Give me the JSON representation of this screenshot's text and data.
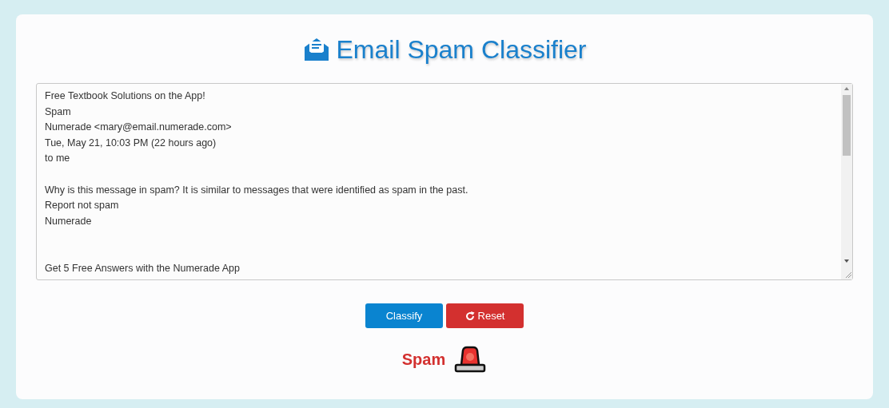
{
  "title": "Email Spam Classifier",
  "message": {
    "value": "Free Textbook Solutions on the App!\nSpam\nNumerade <mary@email.numerade.com>\nTue, May 21, 10:03 PM (22 hours ago)\nto me\n\nWhy is this message in spam? It is similar to messages that were identified as spam in the past.\nReport not spam\nNumerade\n\n\nGet 5 Free Answers with the Numerade App"
  },
  "buttons": [
    {
      "label": "Classify",
      "kind": "primary"
    },
    {
      "label": "Reset",
      "kind": "reset"
    }
  ],
  "result": {
    "label": "Spam",
    "kind": "spam"
  }
}
